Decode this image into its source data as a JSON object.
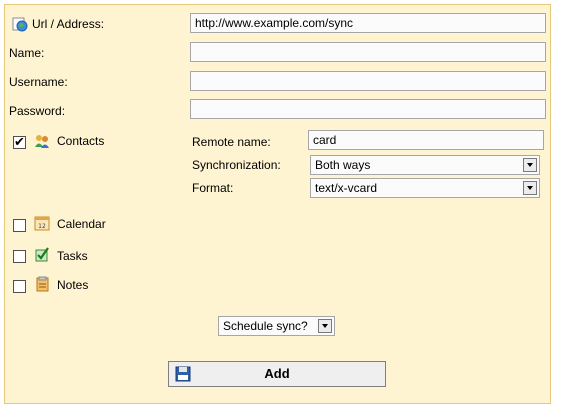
{
  "colors": {
    "panel_background": "#fff4d2",
    "panel_border": "#e7c97c"
  },
  "connection": {
    "url_label": "Url / Address:",
    "url_value": "http://www.example.com/sync",
    "name_label": "Name:",
    "name_value": "",
    "username_label": "Username:",
    "username_value": "",
    "password_label": "Password:",
    "password_value": ""
  },
  "sources": [
    {
      "label": "Contacts",
      "checked": true,
      "icon": "contacts-icon"
    },
    {
      "label": "Calendar",
      "checked": false,
      "icon": "calendar-icon"
    },
    {
      "label": "Tasks",
      "checked": false,
      "icon": "tasks-icon"
    },
    {
      "label": "Notes",
      "checked": false,
      "icon": "notes-icon"
    }
  ],
  "contacts_settings": {
    "remote_name_label": "Remote name:",
    "remote_name_value": "card",
    "sync_label": "Synchronization:",
    "sync_value": "Both ways",
    "format_label": "Format:",
    "format_value": "text/x-vcard"
  },
  "schedule": {
    "label": "Schedule sync?"
  },
  "add_button": {
    "label": "Add",
    "icon": "floppy-disk-icon"
  }
}
